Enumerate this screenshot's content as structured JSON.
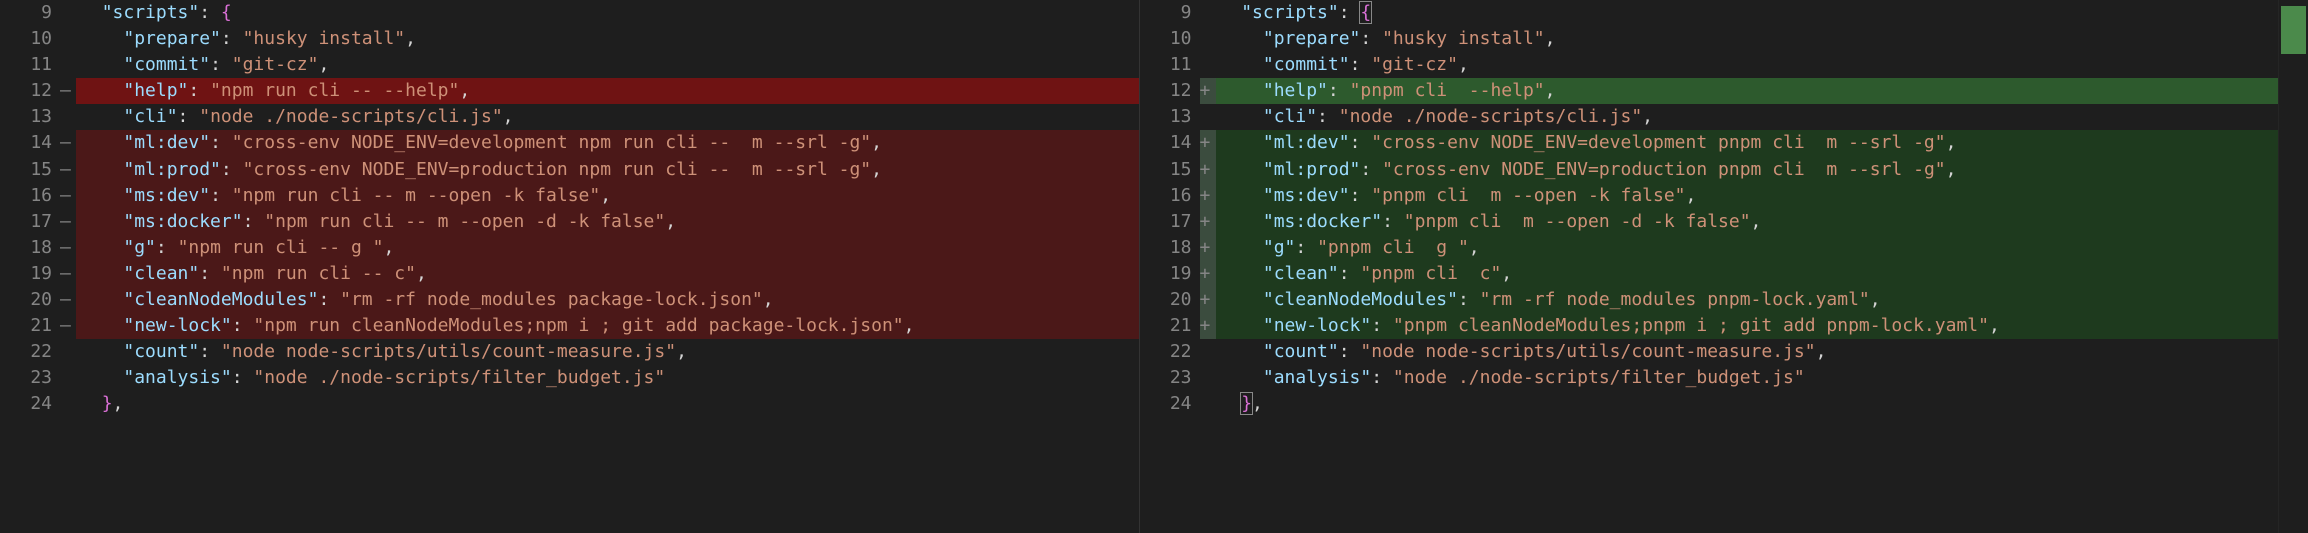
{
  "left": {
    "lines": [
      {
        "num": "9",
        "marker": "",
        "bg": "",
        "indent": 1,
        "key": "\"scripts\"",
        "sep": ": ",
        "val": "{",
        "tail": ""
      },
      {
        "num": "10",
        "marker": "",
        "bg": "",
        "indent": 2,
        "key": "\"prepare\"",
        "sep": ": ",
        "val": "\"husky install\"",
        "tail": ","
      },
      {
        "num": "11",
        "marker": "",
        "bg": "",
        "indent": 2,
        "key": "\"commit\"",
        "sep": ": ",
        "val": "\"git-cz\"",
        "tail": ","
      },
      {
        "num": "12",
        "marker": "—",
        "bg": "removed-strong",
        "indent": 2,
        "key": "\"help\"",
        "sep": ": ",
        "val": "\"npm run cli -- --help\"",
        "tail": ","
      },
      {
        "num": "13",
        "marker": "",
        "bg": "",
        "indent": 2,
        "key": "\"cli\"",
        "sep": ": ",
        "val": "\"node ./node-scripts/cli.js\"",
        "tail": ","
      },
      {
        "num": "14",
        "marker": "—",
        "bg": "removed",
        "indent": 2,
        "key": "\"ml:dev\"",
        "sep": ": ",
        "val": "\"cross-env NODE_ENV=development npm run cli --  m --srl -g\"",
        "tail": ","
      },
      {
        "num": "15",
        "marker": "—",
        "bg": "removed",
        "indent": 2,
        "key": "\"ml:prod\"",
        "sep": ": ",
        "val": "\"cross-env NODE_ENV=production npm run cli --  m --srl -g\"",
        "tail": ","
      },
      {
        "num": "16",
        "marker": "—",
        "bg": "removed",
        "indent": 2,
        "key": "\"ms:dev\"",
        "sep": ": ",
        "val": "\"npm run cli -- m --open -k false\"",
        "tail": ","
      },
      {
        "num": "17",
        "marker": "—",
        "bg": "removed",
        "indent": 2,
        "key": "\"ms:docker\"",
        "sep": ": ",
        "val": "\"npm run cli -- m --open -d -k false\"",
        "tail": ","
      },
      {
        "num": "18",
        "marker": "—",
        "bg": "removed",
        "indent": 2,
        "key": "\"g\"",
        "sep": ": ",
        "val": "\"npm run cli -- g \"",
        "tail": ","
      },
      {
        "num": "19",
        "marker": "—",
        "bg": "removed",
        "indent": 2,
        "key": "\"clean\"",
        "sep": ": ",
        "val": "\"npm run cli -- c\"",
        "tail": ","
      },
      {
        "num": "20",
        "marker": "—",
        "bg": "removed",
        "indent": 2,
        "key": "\"cleanNodeModules\"",
        "sep": ": ",
        "val": "\"rm -rf node_modules package-lock.json\"",
        "tail": ","
      },
      {
        "num": "21",
        "marker": "—",
        "bg": "removed",
        "indent": 2,
        "key": "\"new-lock\"",
        "sep": ": ",
        "val": "\"npm run cleanNodeModules;npm i ; git add package-lock.json\"",
        "tail": ","
      },
      {
        "num": "22",
        "marker": "",
        "bg": "",
        "indent": 2,
        "key": "\"count\"",
        "sep": ": ",
        "val": "\"node node-scripts/utils/count-measure.js\"",
        "tail": ","
      },
      {
        "num": "23",
        "marker": "",
        "bg": "",
        "indent": 2,
        "key": "\"analysis\"",
        "sep": ": ",
        "val": "\"node ./node-scripts/filter_budget.js\"",
        "tail": ""
      },
      {
        "num": "24",
        "marker": "",
        "bg": "",
        "indent": 1,
        "key": "",
        "sep": "",
        "val": "}",
        "tail": ","
      }
    ]
  },
  "right": {
    "lines": [
      {
        "num": "9",
        "marker": "",
        "bg": "",
        "indent": 1,
        "key": "\"scripts\"",
        "sep": ": ",
        "val": "{",
        "tail": "",
        "cursorBrace": true
      },
      {
        "num": "10",
        "marker": "",
        "bg": "",
        "indent": 2,
        "key": "\"prepare\"",
        "sep": ": ",
        "val": "\"husky install\"",
        "tail": ","
      },
      {
        "num": "11",
        "marker": "",
        "bg": "",
        "indent": 2,
        "key": "\"commit\"",
        "sep": ": ",
        "val": "\"git-cz\"",
        "tail": ","
      },
      {
        "num": "12",
        "marker": "+",
        "bg": "added-strong",
        "indent": 2,
        "key": "\"help\"",
        "sep": ": ",
        "val": "\"pnpm cli  --help\"",
        "tail": ","
      },
      {
        "num": "13",
        "marker": "",
        "bg": "",
        "indent": 2,
        "key": "\"cli\"",
        "sep": ": ",
        "val": "\"node ./node-scripts/cli.js\"",
        "tail": ","
      },
      {
        "num": "14",
        "marker": "+",
        "bg": "added",
        "indent": 2,
        "key": "\"ml:dev\"",
        "sep": ": ",
        "val": "\"cross-env NODE_ENV=development pnpm cli  m --srl -g\"",
        "tail": ","
      },
      {
        "num": "15",
        "marker": "+",
        "bg": "added",
        "indent": 2,
        "key": "\"ml:prod\"",
        "sep": ": ",
        "val": "\"cross-env NODE_ENV=production pnpm cli  m --srl -g\"",
        "tail": ","
      },
      {
        "num": "16",
        "marker": "+",
        "bg": "added",
        "indent": 2,
        "key": "\"ms:dev\"",
        "sep": ": ",
        "val": "\"pnpm cli  m --open -k false\"",
        "tail": ","
      },
      {
        "num": "17",
        "marker": "+",
        "bg": "added",
        "indent": 2,
        "key": "\"ms:docker\"",
        "sep": ": ",
        "val": "\"pnpm cli  m --open -d -k false\"",
        "tail": ","
      },
      {
        "num": "18",
        "marker": "+",
        "bg": "added",
        "indent": 2,
        "key": "\"g\"",
        "sep": ": ",
        "val": "\"pnpm cli  g \"",
        "tail": ","
      },
      {
        "num": "19",
        "marker": "+",
        "bg": "added",
        "indent": 2,
        "key": "\"clean\"",
        "sep": ": ",
        "val": "\"pnpm cli  c\"",
        "tail": ","
      },
      {
        "num": "20",
        "marker": "+",
        "bg": "added",
        "indent": 2,
        "key": "\"cleanNodeModules\"",
        "sep": ": ",
        "val": "\"rm -rf node_modules pnpm-lock.yaml\"",
        "tail": ","
      },
      {
        "num": "21",
        "marker": "+",
        "bg": "added",
        "indent": 2,
        "key": "\"new-lock\"",
        "sep": ": ",
        "val": "\"pnpm cleanNodeModules;pnpm i ; git add pnpm-lock.yaml\"",
        "tail": ","
      },
      {
        "num": "22",
        "marker": "",
        "bg": "",
        "indent": 2,
        "key": "\"count\"",
        "sep": ": ",
        "val": "\"node node-scripts/utils/count-measure.js\"",
        "tail": ","
      },
      {
        "num": "23",
        "marker": "",
        "bg": "",
        "indent": 2,
        "key": "\"analysis\"",
        "sep": ": ",
        "val": "\"node ./node-scripts/filter_budget.js\"",
        "tail": ""
      },
      {
        "num": "24",
        "marker": "",
        "bg": "",
        "indent": 1,
        "key": "",
        "sep": "",
        "val": "}",
        "tail": ",",
        "cursorBrace": true
      }
    ]
  }
}
